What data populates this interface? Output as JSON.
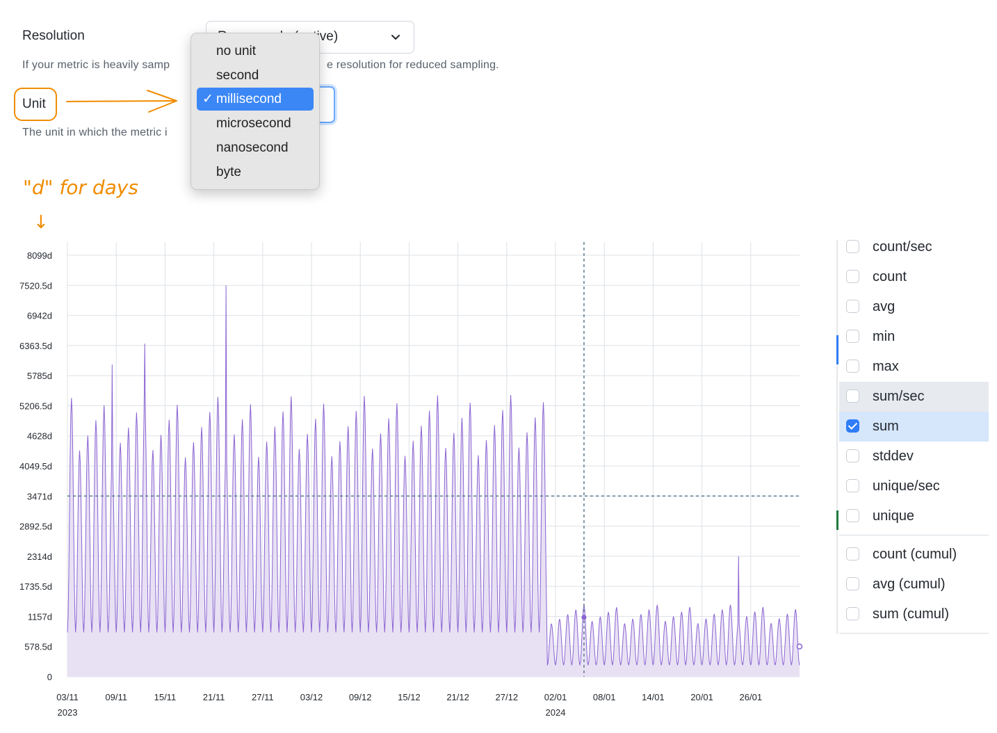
{
  "form": {
    "resolution_label": "Resolution",
    "resolution_value": "Raw sample (native)",
    "resolution_help_left": "If your metric is heavily samp",
    "resolution_help_right": "e resolution for reduced sampling.",
    "unit_label": "Unit",
    "unit_help": "The unit in which the metric i"
  },
  "unit_menu": {
    "options": [
      "no unit",
      "second",
      "millisecond",
      "microsecond",
      "nanosecond",
      "byte"
    ],
    "selected": "millisecond",
    "check_glyph": "✓"
  },
  "annotations": {
    "days_note": "\"d\" for days",
    "down_arrow": "↓",
    "accent_color": "#f08c00"
  },
  "legend": {
    "items": [
      {
        "label": "count/sec",
        "checked": false
      },
      {
        "label": "count",
        "checked": false
      },
      {
        "label": "avg",
        "checked": false
      },
      {
        "label": "min",
        "checked": false
      },
      {
        "label": "max",
        "checked": false
      },
      {
        "label": "sum/sec",
        "checked": false,
        "state": "hover"
      },
      {
        "label": "sum",
        "checked": true,
        "state": "active"
      },
      {
        "label": "stddev",
        "checked": false
      },
      {
        "label": "unique/sec",
        "checked": false
      },
      {
        "label": "unique",
        "checked": false
      }
    ],
    "cumulative_items": [
      {
        "label": "count (cumul)",
        "checked": false
      },
      {
        "label": "avg (cumul)",
        "checked": false
      },
      {
        "label": "sum (cumul)",
        "checked": false
      }
    ]
  },
  "chart_data": {
    "type": "area",
    "title": "",
    "xlabel": "",
    "ylabel": "",
    "y_ticks": [
      "0",
      "578.5d",
      "1157d",
      "1735.5d",
      "2314d",
      "2892.5d",
      "3471d",
      "4049.5d",
      "4628d",
      "5206.5d",
      "5785d",
      "6363.5d",
      "6942d",
      "7520.5d",
      "8099d"
    ],
    "ylim": [
      0,
      8099
    ],
    "x_ticks": [
      "03/11",
      "09/11",
      "15/11",
      "21/11",
      "27/11",
      "03/12",
      "09/12",
      "15/12",
      "21/12",
      "27/12",
      "02/01",
      "08/01",
      "14/01",
      "20/01",
      "26/01"
    ],
    "x_year_labels": [
      {
        "under": "03/11",
        "label": "2023"
      },
      {
        "under": "02/01",
        "label": "2024"
      }
    ],
    "x_range": [
      "2023-11-03",
      "2024-01-31"
    ],
    "crosshair": {
      "date": "2024-01-05",
      "value": 3471
    },
    "grid": true,
    "series": [
      {
        "name": "sum",
        "color": "#8a63d2",
        "fill": "#e8e1f4",
        "unit": "d",
        "daily_pattern": [
          {
            "period": "2023-11-03 to 2023-12-31",
            "daily_min": 850,
            "daily_peak_range": [
              4200,
              5500
            ]
          },
          {
            "period": "2024-01-01 to 2024-01-31",
            "daily_min": 220,
            "daily_peak_range": [
              1000,
              1400
            ]
          }
        ],
        "spikes": [
          {
            "date": "2023-11-08",
            "value": 6000
          },
          {
            "date": "2023-11-12",
            "value": 6400
          },
          {
            "date": "2023-11-22",
            "value": 7520.5
          },
          {
            "date": "2024-01-24",
            "value": 2314
          }
        ]
      }
    ]
  }
}
